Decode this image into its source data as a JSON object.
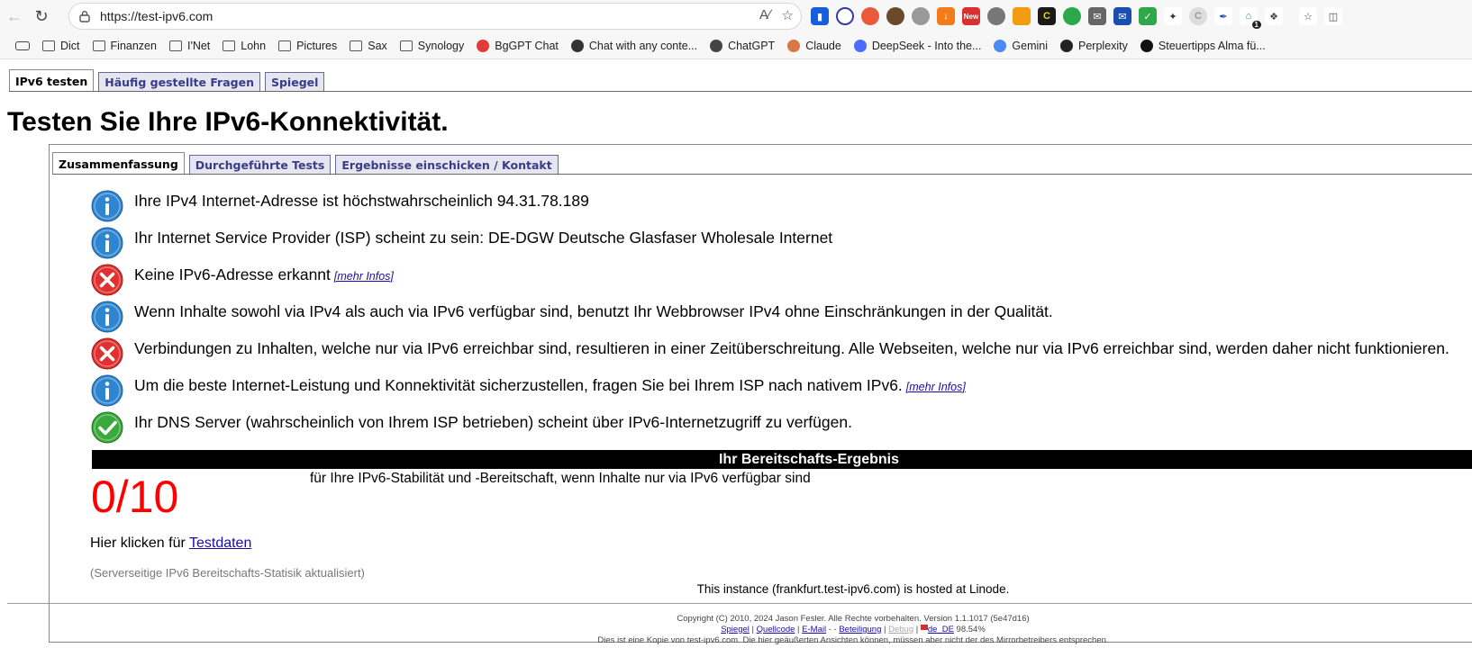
{
  "browser": {
    "url": "https://test-ipv6.com",
    "ext_new_badge": "New",
    "ext_count_badge": "1",
    "bookmarks": [
      {
        "label": "Dict",
        "icon": "folder-icon"
      },
      {
        "label": "Finanzen",
        "icon": "folder-icon"
      },
      {
        "label": "I'Net",
        "icon": "folder-icon"
      },
      {
        "label": "Lohn",
        "icon": "folder-icon"
      },
      {
        "label": "Pictures",
        "icon": "folder-icon"
      },
      {
        "label": "Sax",
        "icon": "folder-icon"
      },
      {
        "label": "Synology",
        "icon": "folder-icon"
      },
      {
        "label": "BgGPT Chat",
        "icon": "bggpt-icon"
      },
      {
        "label": "Chat with any conte...",
        "icon": "sparkle-icon"
      },
      {
        "label": "ChatGPT",
        "icon": "chatgpt-icon"
      },
      {
        "label": "Claude",
        "icon": "claude-icon"
      },
      {
        "label": "DeepSeek - Into the...",
        "icon": "deepseek-icon"
      },
      {
        "label": "Gemini",
        "icon": "gemini-icon"
      },
      {
        "label": "Perplexity",
        "icon": "perplexity-icon"
      },
      {
        "label": "Steuertipps Alma fü...",
        "icon": "steuertipps-icon"
      }
    ]
  },
  "top_tabs": [
    {
      "label": "IPv6 testen",
      "active": true
    },
    {
      "label": "Häufig gestellte Fragen",
      "active": false
    },
    {
      "label": "Spiegel",
      "active": false
    }
  ],
  "title": "Testen Sie Ihre IPv6-Konnektivität.",
  "inner_tabs": [
    {
      "label": "Zusammenfassung",
      "active": true
    },
    {
      "label": "Durchgeführte Tests",
      "active": false
    },
    {
      "label": "Ergebnisse einschicken / Kontakt",
      "active": false
    }
  ],
  "results": [
    {
      "status": "info",
      "text": "Ihre IPv4 Internet-Adresse ist höchstwahrscheinlich 94.31.78.189",
      "link": ""
    },
    {
      "status": "info",
      "text": "Ihr Internet Service Provider (ISP) scheint zu sein: DE-DGW Deutsche Glasfaser Wholesale Internet",
      "link": ""
    },
    {
      "status": "error",
      "text": "Keine IPv6-Adresse erkannt",
      "link": "[mehr Infos]"
    },
    {
      "status": "info",
      "text": "Wenn Inhalte sowohl via IPv4 als auch via IPv6 verfügbar sind, benutzt Ihr Webbrowser IPv4 ohne Einschränkungen in der Qualität.",
      "link": ""
    },
    {
      "status": "error",
      "text": "Verbindungen zu Inhalten, welche nur via IPv6 erreichbar sind, resultieren in einer Zeitüberschreitung. Alle Webseiten, welche nur via IPv6 erreichbar sind, werden daher nicht funktionieren.",
      "link": ""
    },
    {
      "status": "info",
      "text": "Um die beste Internet-Leistung und Konnektivität sicherzustellen, fragen Sie bei Ihrem ISP nach nativem IPv6.",
      "link": "[mehr Infos]"
    },
    {
      "status": "ok",
      "text": "Ihr DNS Server (wahrscheinlich von Ihrem ISP betrieben) scheint über IPv6-Internetzugriff zu verfügen.",
      "link": ""
    }
  ],
  "score": {
    "heading": "Ihr Bereitschafts-Ergebnis",
    "value": "0/10",
    "description": "für Ihre IPv6-Stabilität und -Bereitschaft, wenn Inhalte nur via IPv6 verfügbar sind",
    "color": "#ff0000"
  },
  "testdata": {
    "prefix": "Hier klicken für ",
    "link": "Testdaten"
  },
  "stats_note": "(Serverseitige IPv6 Bereitschafts-Statisik aktualisiert)",
  "hosted": "This instance (frankfurt.test-ipv6.com) is hosted at Linode.",
  "footer": {
    "copyright": "Copyright (C) 2010, 2024 Jason Fesler. Alle Rechte vorbehalten. Version 1.1.1017 (5e47d16)",
    "links": {
      "mirror": "Spiegel",
      "source": "Quellcode",
      "email": "E-Mail",
      "email_suffix": " -   - ",
      "participation": "Beteiligung",
      "debug": "Debug",
      "locale": "de_DE",
      "percent": " 98.54%"
    },
    "disclaimer": "Dies ist eine Kopie von test-ipv6.com. Die hier geäußerten Ansichten können, müssen aber nicht der des Mirrorbetreibers entsprechen."
  },
  "colors": {
    "info": "#2f86d0",
    "error": "#e03030",
    "ok": "#3aa83a",
    "tab_text": "#3b3b8a"
  }
}
